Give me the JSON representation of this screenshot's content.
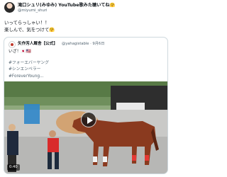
{
  "post": {
    "author_name": "滝口シュリ(みゆみ) YouTube歌みた聴いてね🤗",
    "handle": "@miyumi_shuri",
    "text": "いってらっしゃい！！\n楽しんで、気をつけて🤗"
  },
  "quote": {
    "author_name": "矢作芳人厩舎【公式】",
    "handle_date": "@yahagistable · 9月6日",
    "text": "いざ！🇯🇵🇺🇸",
    "hashtags": "#フォーエバーヤング\n#シンエンペラー\n#ForeverYoung..."
  },
  "video": {
    "timestamp": "0:40",
    "play_icon": "play-icon"
  },
  "colors": {
    "text_primary": "#0f1419",
    "text_secondary": "#536471",
    "border": "#cfd9de"
  }
}
